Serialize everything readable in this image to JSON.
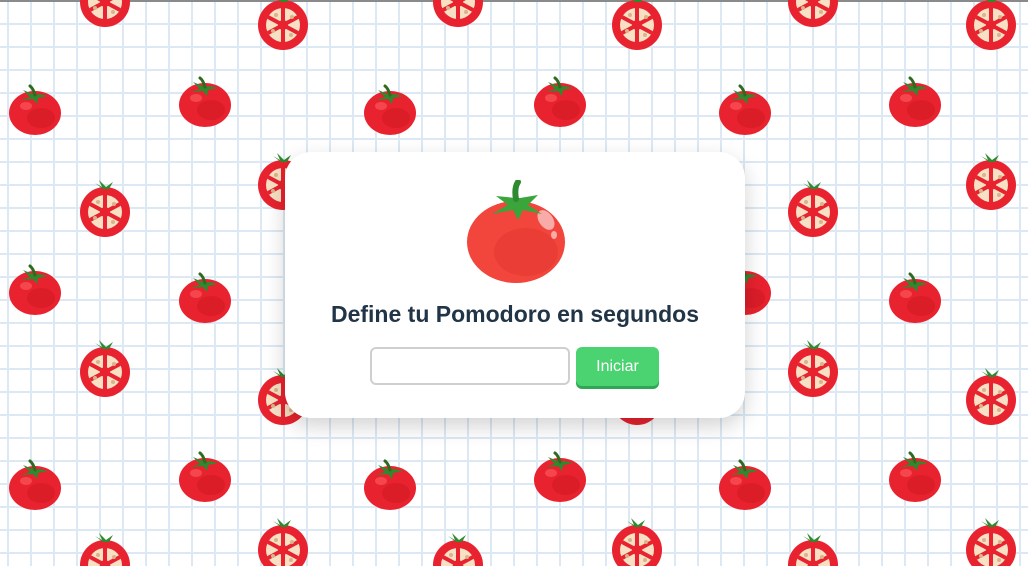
{
  "card": {
    "title": "Define tu Pomodoro en segundos",
    "input": {
      "value": "",
      "placeholder": ""
    },
    "start_label": "Iniciar"
  },
  "icons": {
    "logo": "tomato-icon",
    "pattern_whole": "whole-tomato-icon",
    "pattern_half": "half-tomato-icon"
  },
  "colors": {
    "tomato_red": "#e8222e",
    "leaf_green": "#2f8a2f",
    "button_green": "#4ad370",
    "title_text": "#213547",
    "grid_line": "#dce9f4"
  }
}
